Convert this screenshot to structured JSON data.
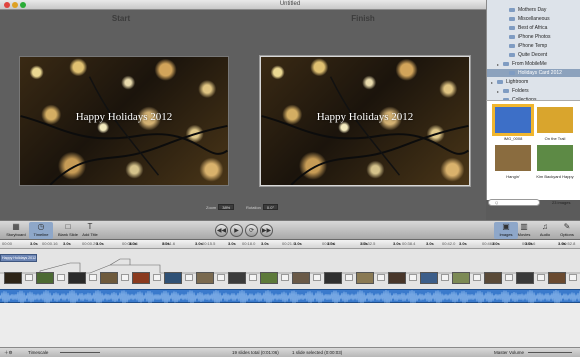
{
  "window": {
    "title": "Untitled"
  },
  "preview": {
    "start_label": "Start",
    "finish_label": "Finish",
    "overlay_title": "Happy Holidays 2012",
    "zoom_label": "Zoom",
    "zoom_value": "38%",
    "rotation_label": "Rotation",
    "rotation_value": "0.0°"
  },
  "transport": {
    "rewind_icon": "rewind-icon",
    "play_icon": "play-icon",
    "loop_icon": "loop-icon",
    "forward_icon": "forward-icon"
  },
  "sidebar": {
    "items": [
      {
        "label": "Mothers Day",
        "selected": false,
        "indent": 2
      },
      {
        "label": "Miscellaneous",
        "selected": false,
        "indent": 2
      },
      {
        "label": "Best of Africa",
        "selected": false,
        "indent": 2
      },
      {
        "label": "iPhone Photos",
        "selected": false,
        "indent": 2
      },
      {
        "label": "iPhone Temp",
        "selected": false,
        "indent": 2
      },
      {
        "label": "Quite Decent",
        "selected": false,
        "indent": 2
      },
      {
        "label": "From MobileMe",
        "selected": false,
        "indent": 1
      },
      {
        "label": "Holidays Card 2012",
        "selected": true,
        "indent": 2
      },
      {
        "label": "Lightroom",
        "selected": false,
        "indent": 0
      },
      {
        "label": "Folders",
        "selected": false,
        "indent": 1
      },
      {
        "label": "Collections",
        "selected": false,
        "indent": 1
      }
    ],
    "thumbs": [
      {
        "caption": "IMG_0008",
        "selected": true,
        "color": "#3d6fc7"
      },
      {
        "caption": "On the Trail",
        "selected": false,
        "color": "#d9a52d"
      },
      {
        "caption": "Hangin'",
        "selected": false,
        "color": "#8a6c3f"
      },
      {
        "caption": "Kim Backyard Happy",
        "selected": false,
        "color": "#5d8a45"
      }
    ],
    "search_placeholder": "Q",
    "image_count": "23 images"
  },
  "toolbar": {
    "storyboard": "Storyboard",
    "timeline": "Timeline",
    "blank_slide": "Blank Slide",
    "add_title": "Add Title",
    "images": "Images",
    "movies": "Movies",
    "audio": "Audio",
    "options": "Options"
  },
  "timeline": {
    "ticks": [
      "00:00",
      "00:00.16",
      "00:00.29",
      "00:08.18",
      "00:11.6",
      "00:15.5",
      "00:18.0",
      "00:21.0",
      "00:27.6",
      "00:32.5",
      "00:38.4",
      "00:42.0",
      "00:46.8",
      "00:50.6",
      "00:52.8"
    ],
    "durations": [
      "3.0s",
      "3.0s",
      "3.0s",
      "3.0s",
      "3.0s",
      "3.0s",
      "3.0s",
      "3.0s",
      "3.0s",
      "3.0s",
      "3.0s",
      "3.0s",
      "3.0s",
      "3.0s",
      "3.0s",
      "3.0s",
      "3.0s"
    ],
    "title_clip": "Happy Holidays 2012",
    "clip_colors": [
      "#2d2417",
      "#4c6a33",
      "#2a2a2a",
      "#6e5a3c",
      "#8a3a1e",
      "#2f5176",
      "#7a6a50",
      "#3b3b3b",
      "#5d7a3a",
      "#6a5a48",
      "#2f2f2f",
      "#8a7a55",
      "#48362a",
      "#3c5e8a",
      "#7c8a55",
      "#5a4a38",
      "#3a3a3a",
      "#6a4a30"
    ]
  },
  "status": {
    "timescale_label": "Timescale",
    "slide_counts": "19 slides total (0:01:06)",
    "selection": "1 slide selected (0:00:03)",
    "master_volume": "Master Volume"
  }
}
